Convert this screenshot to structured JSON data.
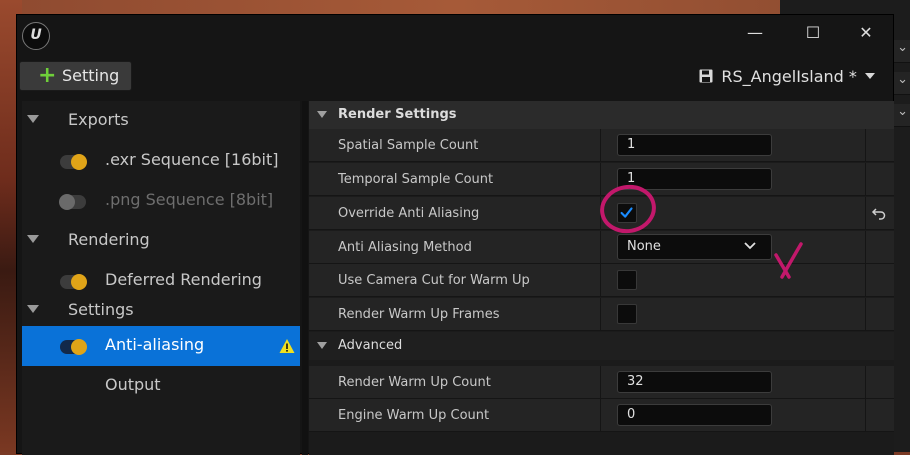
{
  "window": {
    "logo_text": "U",
    "minimize": "—",
    "maximize": "☐",
    "close": "✕"
  },
  "toolbar": {
    "add_label": "Setting",
    "preset_name": "RS_AngelIsland *"
  },
  "tree": [
    {
      "type": "category",
      "label": "Exports"
    },
    {
      "type": "item",
      "label": ".exr Sequence [16bit]",
      "enabled": true
    },
    {
      "type": "item",
      "label": ".png Sequence [8bit]",
      "enabled": false
    },
    {
      "type": "category",
      "label": "Rendering"
    },
    {
      "type": "item",
      "label": "Deferred Rendering",
      "enabled": true
    },
    {
      "type": "category",
      "label": "Settings"
    },
    {
      "type": "item",
      "label": "Anti-aliasing",
      "enabled": true,
      "selected": true,
      "warning": true
    },
    {
      "type": "item",
      "label": "Output",
      "enabled": null
    }
  ],
  "details": {
    "render_settings": {
      "header": "Render Settings",
      "spatial_sample_count": {
        "label": "Spatial Sample Count",
        "value": "1"
      },
      "temporal_sample_count": {
        "label": "Temporal Sample Count",
        "value": "1"
      },
      "override_anti_aliasing": {
        "label": "Override Anti Aliasing",
        "checked": true
      },
      "anti_aliasing_method": {
        "label": "Anti Aliasing Method",
        "value": "None"
      },
      "use_camera_cut": {
        "label": "Use Camera Cut for Warm Up",
        "checked": false
      },
      "render_warm_up_frames": {
        "label": "Render Warm Up Frames",
        "checked": false
      }
    },
    "advanced": {
      "header": "Advanced",
      "render_warm_up_count": {
        "label": "Render Warm Up Count",
        "value": "32"
      },
      "engine_warm_up_count": {
        "label": "Engine Warm Up Count",
        "value": "0"
      }
    }
  },
  "colors": {
    "accent": "#0a72d8",
    "toggle_on": "#e0a418",
    "annotation": "#c2186b",
    "add_icon": "#6fcf3a"
  }
}
